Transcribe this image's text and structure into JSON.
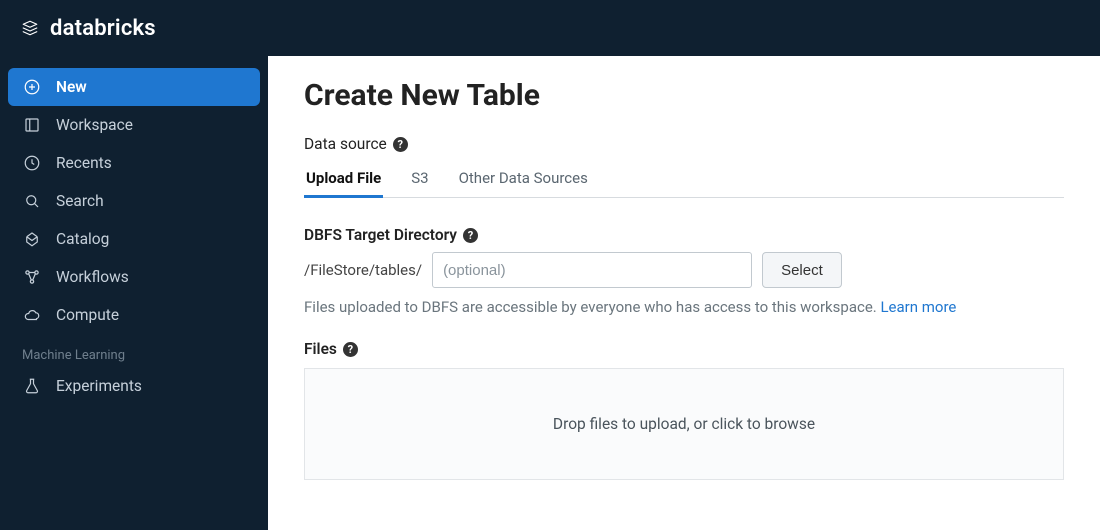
{
  "header": {
    "brand": "databricks"
  },
  "sidebar": {
    "items": [
      {
        "label": "New",
        "icon": "plus-circle-icon",
        "active": true
      },
      {
        "label": "Workspace",
        "icon": "workspace-icon",
        "active": false
      },
      {
        "label": "Recents",
        "icon": "clock-icon",
        "active": false
      },
      {
        "label": "Search",
        "icon": "search-icon",
        "active": false
      },
      {
        "label": "Catalog",
        "icon": "catalog-icon",
        "active": false
      },
      {
        "label": "Workflows",
        "icon": "workflows-icon",
        "active": false
      },
      {
        "label": "Compute",
        "icon": "cloud-icon",
        "active": false
      }
    ],
    "section_label": "Machine Learning",
    "section_items": [
      {
        "label": "Experiments",
        "icon": "flask-icon"
      }
    ]
  },
  "main": {
    "title": "Create New Table",
    "data_source_label": "Data source",
    "tabs": [
      {
        "label": "Upload File",
        "active": true
      },
      {
        "label": "S3",
        "active": false
      },
      {
        "label": "Other Data Sources",
        "active": false
      }
    ],
    "dbfs": {
      "label": "DBFS Target Directory",
      "prefix": "/FileStore/tables/",
      "placeholder": "(optional)",
      "value": "",
      "select_button": "Select",
      "helper_text": "Files uploaded to DBFS are accessible by everyone who has access to this workspace. ",
      "learn_more": "Learn more"
    },
    "files": {
      "label": "Files",
      "dropzone_text": "Drop files to upload, or click to browse"
    }
  }
}
